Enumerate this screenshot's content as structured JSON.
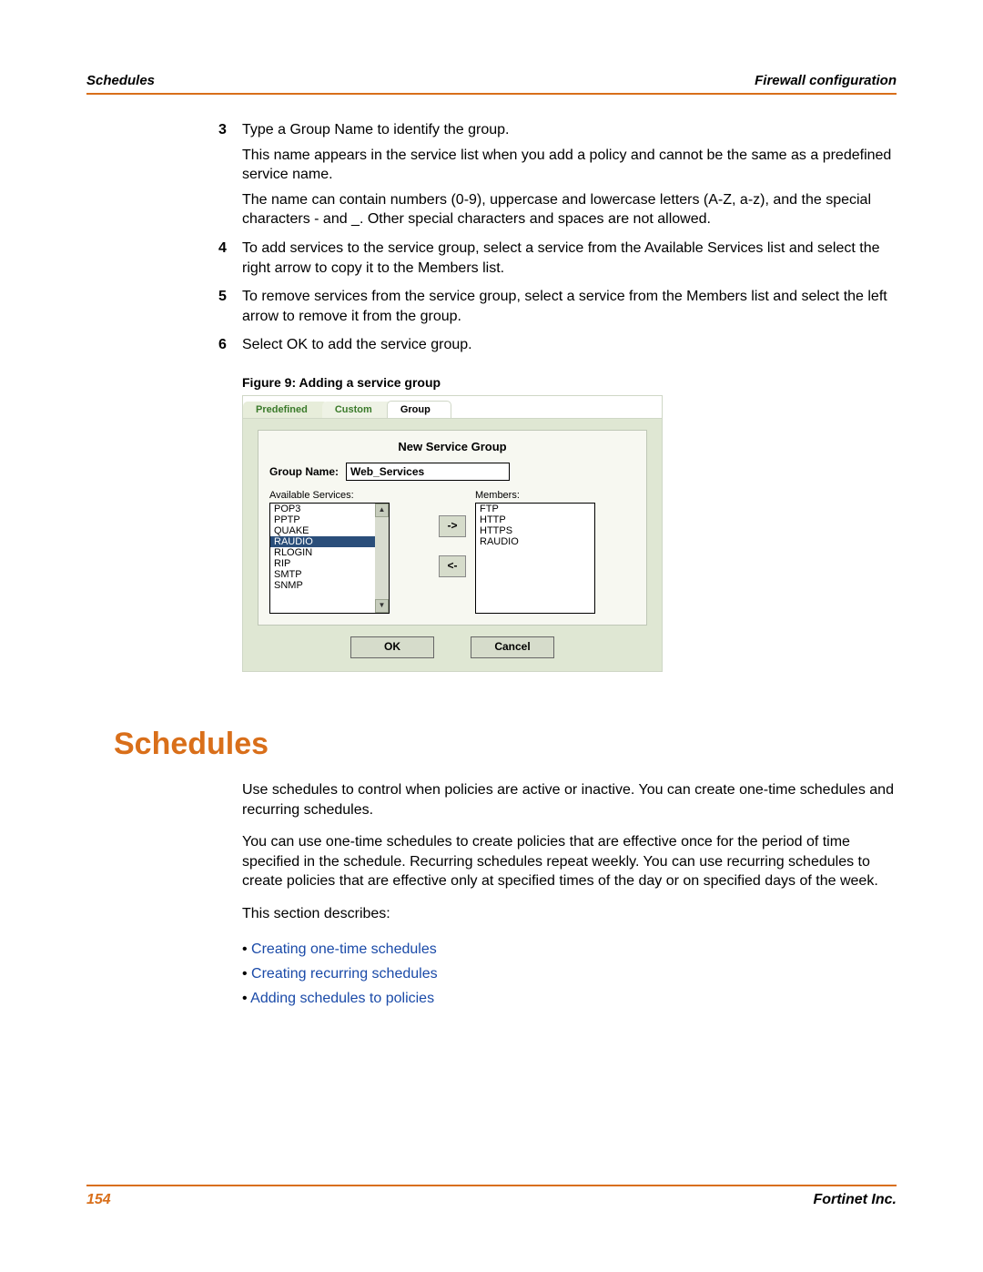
{
  "header": {
    "left": "Schedules",
    "right": "Firewall configuration"
  },
  "steps": {
    "s3": {
      "num": "3",
      "p1": "Type a Group Name to identify the group.",
      "p2": "This name appears in the service list when you add a policy and cannot be the same as a predefined service name.",
      "p3": "The name can contain numbers (0-9), uppercase and lowercase letters (A-Z, a-z), and the special characters - and _. Other special characters and spaces are not allowed."
    },
    "s4": {
      "num": "4",
      "p1": "To add services to the service group, select a service from the Available Services list and select the right arrow to copy it to the Members list."
    },
    "s5": {
      "num": "5",
      "p1": "To remove services from the service group, select a service from the Members list and select the left arrow to remove it from the group."
    },
    "s6": {
      "num": "6",
      "p1": "Select OK to add the service group."
    }
  },
  "figure_caption": "Figure 9:  Adding a service group",
  "dialog": {
    "tabs": {
      "predefined": "Predefined",
      "custom": "Custom",
      "group": "Group"
    },
    "title": "New Service Group",
    "group_name_label": "Group Name:",
    "group_name_value": "Web_Services",
    "available_label": "Available Services:",
    "members_label": "Members:",
    "available": [
      "POP3",
      "PPTP",
      "QUAKE",
      "RAUDIO",
      "RLOGIN",
      "RIP",
      "SMTP",
      "SNMP"
    ],
    "available_selected_index": 3,
    "members": [
      "FTP",
      "HTTP",
      "HTTPS",
      "RAUDIO"
    ],
    "arrow_right": "->",
    "arrow_left": "<-",
    "ok": "OK",
    "cancel": "Cancel"
  },
  "section": {
    "heading": "Schedules",
    "p1": "Use schedules to control when policies are active or inactive. You can create one-time schedules and recurring schedules.",
    "p2": "You can use one-time schedules to create policies that are effective once for the period of time specified in the schedule. Recurring schedules repeat weekly. You can use recurring schedules to create policies that are effective only at specified times of the day or on specified days of the week.",
    "p3": "This section describes:",
    "links": {
      "l1": "Creating one-time schedules",
      "l2": "Creating recurring schedules",
      "l3": "Adding schedules to policies"
    }
  },
  "footer": {
    "page_num": "154",
    "right": "Fortinet Inc."
  }
}
